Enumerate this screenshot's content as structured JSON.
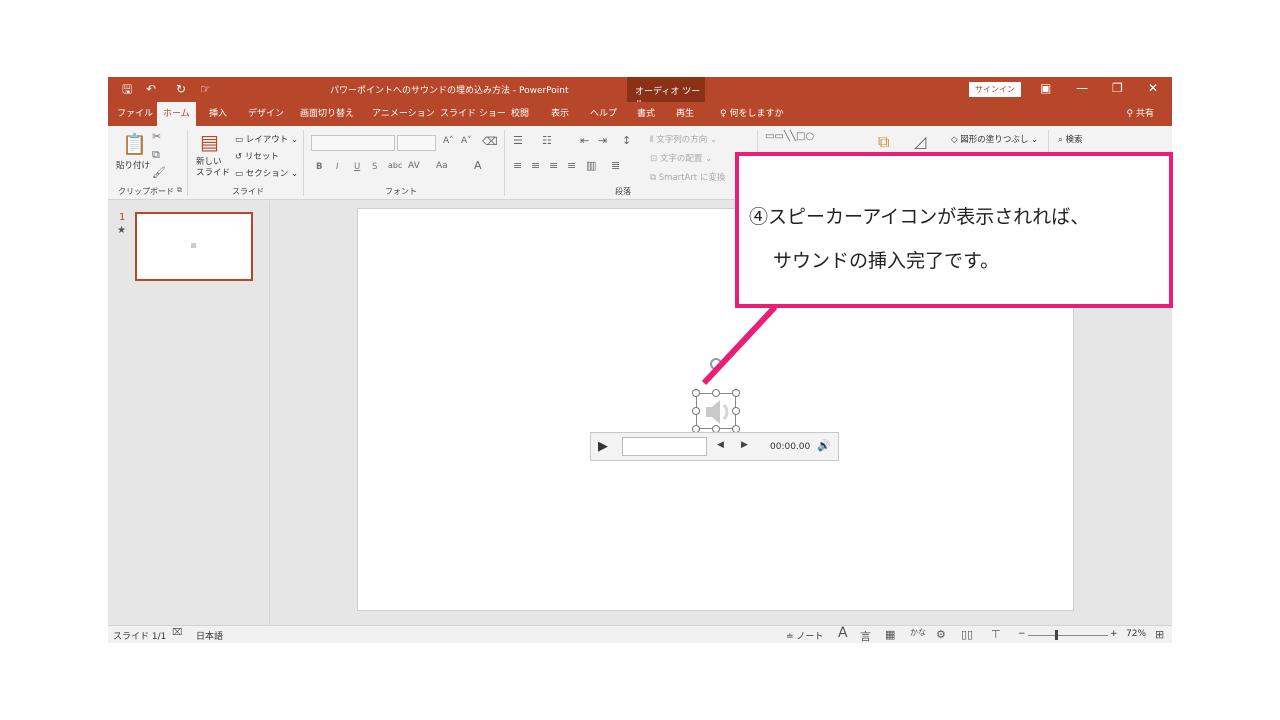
{
  "window": {
    "title": "パワーポイントへのサウンドの埋め込み方法 - PowerPoint",
    "context_group": "オーディオ ツール",
    "signin": "サインイン",
    "quick_access": {
      "save": "🖫",
      "undo": "↶",
      "redo": "↻",
      "touch": "☞"
    },
    "controls": {
      "ribbon_display": "▣",
      "minimize": "—",
      "restore": "❐",
      "close": "✕"
    }
  },
  "tabs": [
    {
      "label": "ファイル"
    },
    {
      "label": "ホーム"
    },
    {
      "label": "挿入"
    },
    {
      "label": "デザイン"
    },
    {
      "label": "画面切り替え"
    },
    {
      "label": "アニメーション"
    },
    {
      "label": "スライド ショー"
    },
    {
      "label": "校閲"
    },
    {
      "label": "表示"
    },
    {
      "label": "ヘルプ"
    },
    {
      "label": "書式"
    },
    {
      "label": "再生"
    }
  ],
  "tell_me": "何をしますか",
  "share": "共有",
  "ribbon": {
    "clipboard": {
      "paste": "貼り付け",
      "label": "クリップボード"
    },
    "slides": {
      "new_slide": "新しい\nスライド",
      "layout": "レイアウト",
      "reset": "リセット",
      "section": "セクション",
      "label": "スライド"
    },
    "font": {
      "label": "フォント",
      "bold": "B",
      "italic": "I",
      "underline": "U",
      "shadow": "S"
    },
    "paragraph": {
      "label": "段落",
      "text_direction": "文字列の方向",
      "align_text": "文字の配置",
      "smartart": "SmartArt に変換"
    },
    "drawing": {
      "shape_fill": "図形の塗りつぶし"
    },
    "editing": {
      "find": "検索"
    }
  },
  "thumbnails": {
    "slide_number": "1",
    "star": "★"
  },
  "audio_player": {
    "play": "▶",
    "back": "◀",
    "forward": "▶",
    "time": "00:00.00",
    "volume": "🔊"
  },
  "status": {
    "slide_counter": "スライド 1/1",
    "language": "日本語",
    "notes": "ノート",
    "zoom_percent": "72%",
    "zoom_minus": "−",
    "zoom_plus": "+"
  },
  "callout": {
    "line1": "④スピーカーアイコンが表示されれば、",
    "line2": "サウンドの挿入完了です。",
    "border_color": "#ea1e78"
  },
  "colors": {
    "ppt_accent": "#b7472a",
    "context_tab": "#8a3118",
    "callout": "#ea1e78"
  }
}
